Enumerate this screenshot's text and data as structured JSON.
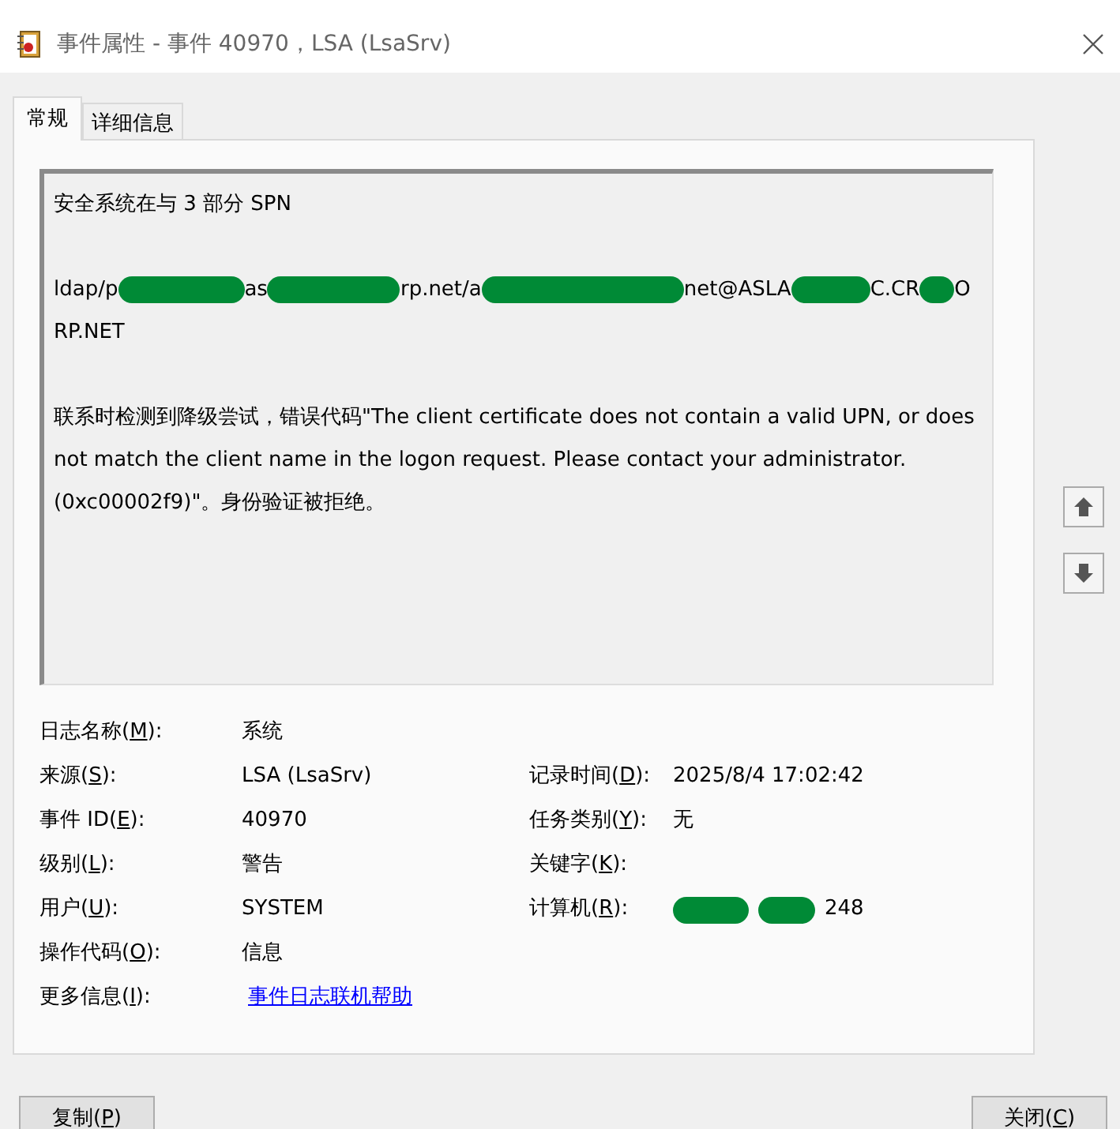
{
  "window": {
    "title": "事件属性 - 事件 40970，LSA (LsaSrv)"
  },
  "tabs": [
    {
      "label": "常规",
      "selected": true
    },
    {
      "label": "详细信息",
      "selected": false
    }
  ],
  "description": {
    "paragraphs": [
      [
        [
          {
            "kind": "text",
            "text": "安全系统在与 3 部分 SPN"
          }
        ]
      ],
      [
        [
          {
            "kind": "text",
            "text": "ldap/p"
          },
          {
            "kind": "redaction"
          },
          {
            "kind": "text",
            "text": "as"
          },
          {
            "kind": "redaction"
          },
          {
            "kind": "text",
            "text": "rp.net/a"
          },
          {
            "kind": "redaction"
          },
          {
            "kind": "text",
            "text": "net@ASLA"
          },
          {
            "kind": "redaction"
          },
          {
            "kind": "text",
            "text": "C.CR"
          },
          {
            "kind": "redaction"
          },
          {
            "kind": "text",
            "text": "O"
          }
        ],
        [
          {
            "kind": "text",
            "text": "RP.NET"
          }
        ]
      ],
      [
        [
          {
            "kind": "text",
            "text": " 联系时检测到降级尝试，错误代码\"The client certificate does not contain a valid UPN, or does not match the client name in the logon request. Please contact your administrator. (0xc00002f9)\"。身份验证被拒绝。"
          }
        ]
      ]
    ]
  },
  "scroll_buttons": [
    {
      "kind": "up"
    },
    {
      "kind": "down"
    }
  ],
  "fields": [
    [
      {
        "label": [
          "日志名称(",
          "M",
          "):"
        ],
        "value": [
          {
            "kind": "text",
            "text": "系统"
          }
        ]
      }
    ],
    [
      {
        "label": [
          "来源(",
          "S",
          "):"
        ],
        "value": [
          {
            "kind": "text",
            "text": "LSA (LsaSrv)"
          }
        ]
      },
      {
        "label": [
          "记录时间(",
          "D",
          "):"
        ],
        "value": [
          {
            "kind": "text",
            "text": "2025/8/4 17:02:42"
          }
        ]
      }
    ],
    [
      {
        "label": [
          "事件 ID(",
          "E",
          "):"
        ],
        "value": [
          {
            "kind": "text",
            "text": "40970"
          }
        ]
      },
      {
        "label": [
          "任务类别(",
          "Y",
          "):"
        ],
        "value": [
          {
            "kind": "text",
            "text": "无"
          }
        ]
      }
    ],
    [
      {
        "label": [
          "级别(",
          "L",
          "):"
        ],
        "value": [
          {
            "kind": "text",
            "text": "警告"
          }
        ]
      },
      {
        "label": [
          "关键字(",
          "K",
          "):"
        ]
      }
    ],
    [
      {
        "label": [
          "用户(",
          "U",
          "):"
        ],
        "value": [
          {
            "kind": "text",
            "text": "SYSTEM"
          }
        ]
      },
      {
        "label": [
          "计算机(",
          "R",
          "):"
        ],
        "value": [
          {
            "kind": "redaction"
          },
          {
            "kind": "redaction"
          },
          {
            "kind": "text",
            "text": "248"
          }
        ]
      }
    ],
    [
      {
        "label": [
          "操作代码(",
          "O",
          "):"
        ],
        "value": [
          {
            "kind": "text",
            "text": "信息"
          }
        ]
      }
    ],
    [
      {
        "label": [
          "更多信息(",
          "I",
          "):"
        ],
        "value": [
          {
            "kind": "link",
            "text": "事件日志联机帮助"
          }
        ]
      }
    ]
  ],
  "buttons": [
    {
      "label": [
        "复制(",
        "P",
        ")"
      ]
    },
    {
      "label": [
        "关闭(",
        "C",
        ")"
      ]
    }
  ]
}
